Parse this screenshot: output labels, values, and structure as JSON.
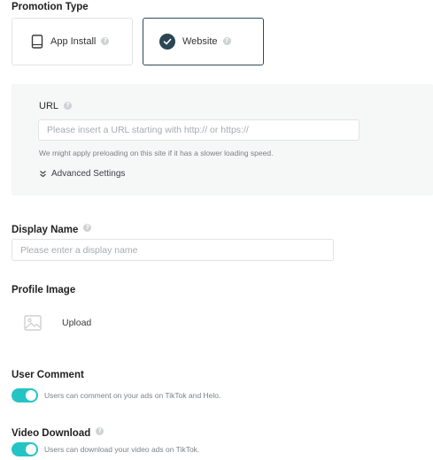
{
  "promotion": {
    "title": "Promotion Type",
    "app_install_label": "App Install",
    "website_label": "Website",
    "selected": "Website"
  },
  "url": {
    "label": "URL",
    "placeholder": "Please insert a URL starting with http:// or https://",
    "hint": "We might apply preloading on this site if it has a slower loading speed.",
    "advanced_label": "Advanced Settings"
  },
  "display_name": {
    "label": "Display Name",
    "placeholder": "Please enter a display name"
  },
  "profile_image": {
    "label": "Profile Image",
    "upload_label": "Upload"
  },
  "user_comment": {
    "label": "User Comment",
    "enabled": true,
    "description": "Users can comment on your ads on TikTok and Helo."
  },
  "video_download": {
    "label": "Video Download",
    "enabled": true,
    "description": "Users can download your video ads on TikTok."
  },
  "colors": {
    "accent": "#25c4c4",
    "selected_border": "#2f4a56",
    "check_fill": "#2b4552"
  }
}
